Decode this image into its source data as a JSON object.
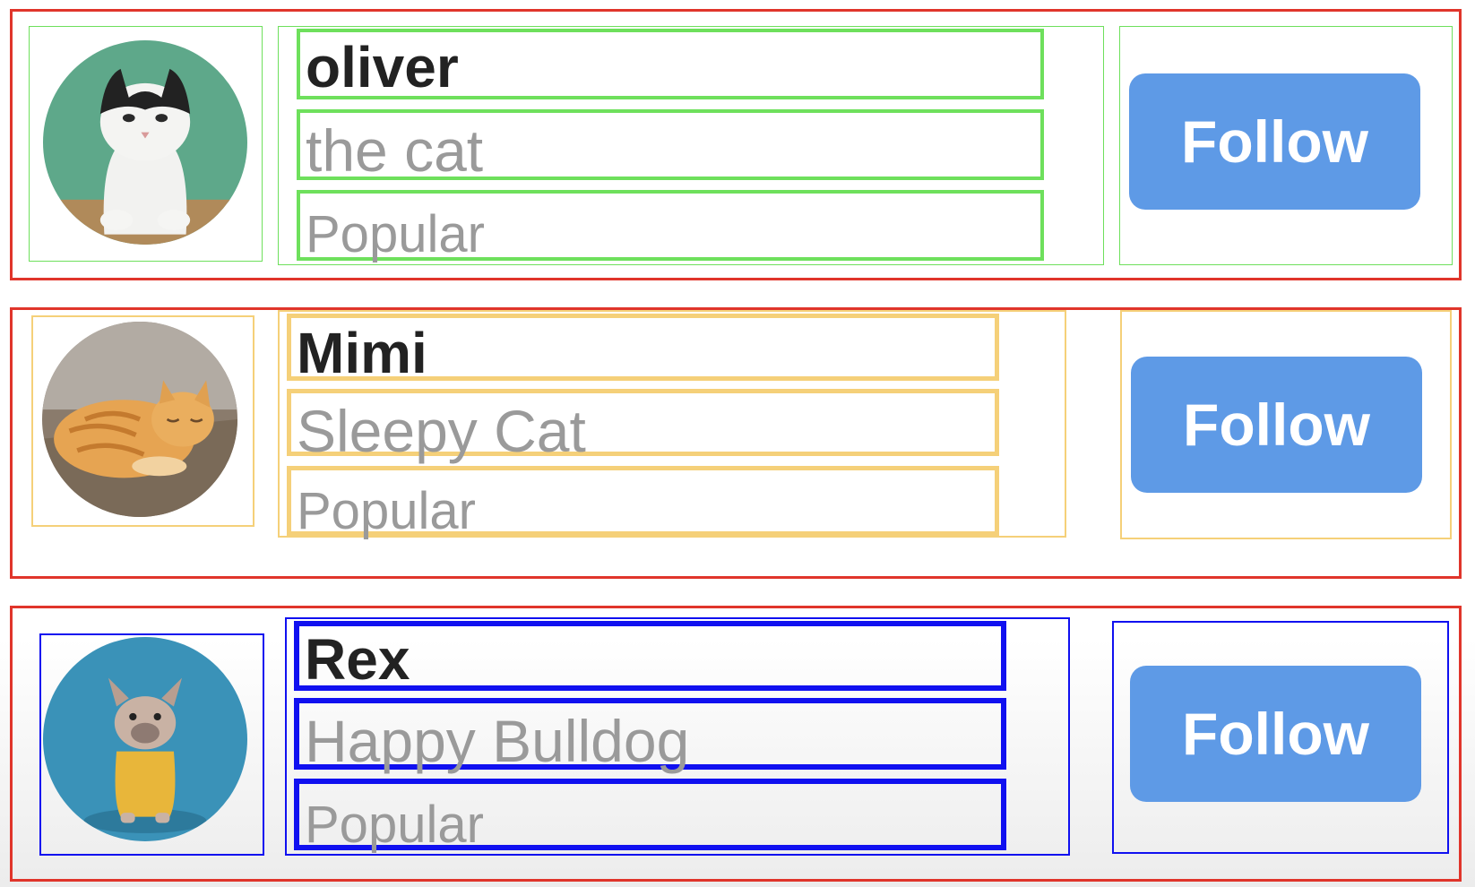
{
  "profiles": [
    {
      "name": "oliver",
      "subtitle": "the cat",
      "tag": "Popular",
      "follow_label": "Follow",
      "avatar_icon": "tuxedo-cat-avatar",
      "highlight_color": "#6ee05c"
    },
    {
      "name": "Mimi",
      "subtitle": "Sleepy Cat",
      "tag": "Popular",
      "follow_label": "Follow",
      "avatar_icon": "orange-cat-avatar",
      "highlight_color": "#f5d079"
    },
    {
      "name": "Rex",
      "subtitle": "Happy Bulldog",
      "tag": "Popular",
      "follow_label": "Follow",
      "avatar_icon": "bulldog-avatar",
      "highlight_color": "#1010f0"
    }
  ],
  "colors": {
    "card_border": "#e0352b",
    "button": "#5e9ae6",
    "name_text": "#222222",
    "secondary_text": "#9a9a9a"
  }
}
